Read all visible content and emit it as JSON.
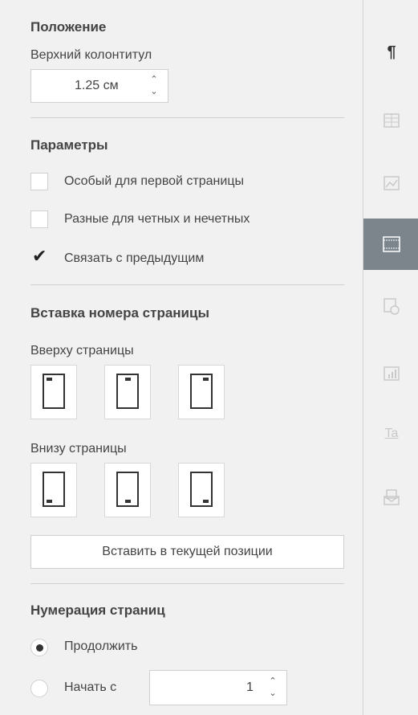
{
  "position": {
    "title": "Положение",
    "header_label": "Верхний колонтитул",
    "header_value": "1.25 см"
  },
  "params": {
    "title": "Параметры",
    "options": [
      {
        "label": "Особый для первой страницы",
        "checked": false
      },
      {
        "label": "Разные для четных и нечетных",
        "checked": false
      },
      {
        "label": "Связать с предыдущим",
        "checked": true
      }
    ]
  },
  "page_number": {
    "title": "Вставка номера страницы",
    "top_label": "Вверху страницы",
    "bottom_label": "Внизу страницы",
    "insert_button": "Вставить в текущей позиции"
  },
  "numbering": {
    "title": "Нумерация страниц",
    "continue_label": "Продолжить",
    "start_label": "Начать с",
    "start_value": "1",
    "selected": "continue"
  },
  "rightbar": {
    "icons": [
      "paragraph-icon",
      "table-icon",
      "image-icon",
      "header-footer-icon",
      "shape-icon",
      "chart-icon",
      "text-art-icon",
      "mail-merge-icon"
    ],
    "active": "header-footer-icon",
    "paragraph_glyph": "¶",
    "text_art_glyph": "Ta"
  },
  "glyphs": {
    "up_arrow": "⌃",
    "down_arrow": "⌄",
    "check": "✔"
  },
  "colors": {
    "background": "#f1f1f1",
    "active_tab": "#7d858c",
    "text": "#444444"
  }
}
